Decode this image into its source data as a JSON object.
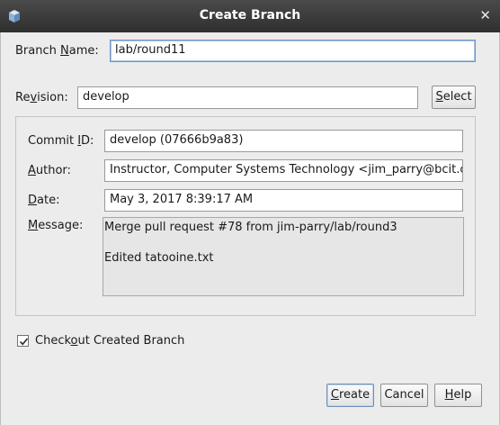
{
  "window": {
    "title": "Create Branch",
    "close_glyph": "✕",
    "icon": "netbeans-cube-icon"
  },
  "branch_name": {
    "label_pre": "Branch ",
    "label_mnemonic": "N",
    "label_post": "ame:",
    "value": "lab/round11"
  },
  "revision": {
    "label_pre": "Re",
    "label_mnemonic": "v",
    "label_post": "ision:",
    "value": "develop",
    "select_pre": "",
    "select_mnemonic": "S",
    "select_post": "elect"
  },
  "details": {
    "commit_id": {
      "label_pre": "Commit ",
      "label_mnemonic": "I",
      "label_post": "D:",
      "value": "develop (07666b9a83)"
    },
    "author": {
      "label_pre": "",
      "label_mnemonic": "A",
      "label_post": "uthor:",
      "value": "Instructor, Computer Systems Technology <jim_parry@bcit.c"
    },
    "date": {
      "label_pre": "",
      "label_mnemonic": "D",
      "label_post": "ate:",
      "value": "May 3, 2017 8:39:17 AM"
    },
    "message": {
      "label_pre": "",
      "label_mnemonic": "M",
      "label_post": "essage:",
      "line1": "Merge pull request #78 from jim-parry/lab/round3",
      "line2": "",
      "line3": "Edited tatooine.txt"
    }
  },
  "checkout": {
    "checked": true,
    "label_pre": "Check",
    "label_mnemonic": "o",
    "label_post": "ut Created Branch"
  },
  "buttons": {
    "create": {
      "pre": "",
      "mnemonic": "C",
      "post": "reate"
    },
    "cancel": {
      "label": "Cancel"
    },
    "help": {
      "pre": "",
      "mnemonic": "H",
      "post": "elp"
    }
  },
  "colors": {
    "titlebar": "#3a3a3a",
    "dialog_bg": "#ececec",
    "focus_border": "#6e95c4"
  }
}
